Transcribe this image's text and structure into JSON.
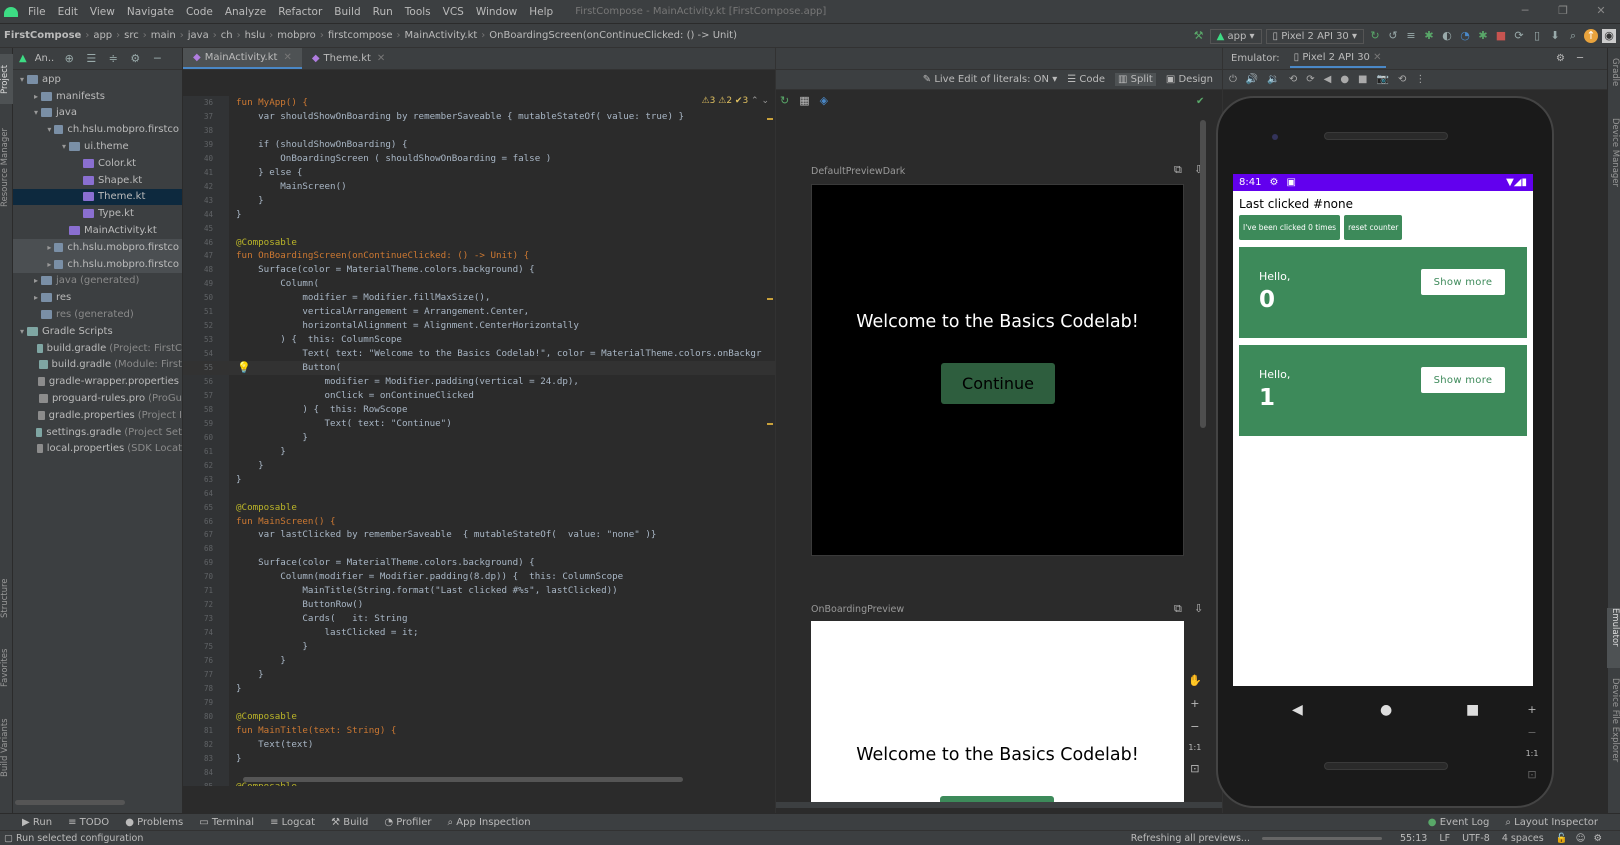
{
  "menu": {
    "items": [
      "File",
      "Edit",
      "View",
      "Navigate",
      "Code",
      "Analyze",
      "Refactor",
      "Build",
      "Run",
      "Tools",
      "VCS",
      "Window",
      "Help"
    ],
    "window_title": "FirstCompose - MainActivity.kt [FirstCompose.app]"
  },
  "nav": {
    "crumbs": [
      "FirstCompose",
      "app",
      "src",
      "main",
      "java",
      "ch",
      "hslu",
      "mobpro",
      "firstcompose",
      "MainActivity.kt",
      "OnBoardingScreen(onContinueClicked: () -> Unit)"
    ],
    "run_config": "app",
    "device": "Pixel 2 API 30"
  },
  "project": {
    "header": "An..",
    "tree": [
      {
        "label": "app",
        "extra": "",
        "depth": 0,
        "arrow": "▾",
        "icon": "folder",
        "cls": ""
      },
      {
        "label": "manifests",
        "extra": "",
        "depth": 1,
        "arrow": "▸",
        "icon": "folder",
        "cls": ""
      },
      {
        "label": "java",
        "extra": "",
        "depth": 1,
        "arrow": "▾",
        "icon": "folder",
        "cls": ""
      },
      {
        "label": "ch.hslu.mobpro.firstco",
        "extra": "",
        "depth": 2,
        "arrow": "▾",
        "icon": "pkg",
        "cls": ""
      },
      {
        "label": "ui.theme",
        "extra": "",
        "depth": 3,
        "arrow": "▾",
        "icon": "pkg",
        "cls": ""
      },
      {
        "label": "Color.kt",
        "extra": "",
        "depth": 4,
        "arrow": "",
        "icon": "kt",
        "cls": ""
      },
      {
        "label": "Shape.kt",
        "extra": "",
        "depth": 4,
        "arrow": "",
        "icon": "kt",
        "cls": ""
      },
      {
        "label": "Theme.kt",
        "extra": "",
        "depth": 4,
        "arrow": "",
        "icon": "kt",
        "cls": "sel"
      },
      {
        "label": "Type.kt",
        "extra": "",
        "depth": 4,
        "arrow": "",
        "icon": "kt",
        "cls": ""
      },
      {
        "label": "MainActivity.kt",
        "extra": "",
        "depth": 3,
        "arrow": "",
        "icon": "kt",
        "cls": ""
      },
      {
        "label": "ch.hslu.mobpro.firstco",
        "extra": "",
        "depth": 2,
        "arrow": "▸",
        "icon": "pkg",
        "cls": "sel2"
      },
      {
        "label": "ch.hslu.mobpro.firstco",
        "extra": "",
        "depth": 2,
        "arrow": "▸",
        "icon": "pkg",
        "cls": "sel2"
      },
      {
        "label": "java",
        "extra": "(generated)",
        "depth": 1,
        "arrow": "▸",
        "icon": "folder",
        "cls": ""
      },
      {
        "label": "res",
        "extra": "",
        "depth": 1,
        "arrow": "▸",
        "icon": "folder",
        "cls": ""
      },
      {
        "label": "res",
        "extra": "(generated)",
        "depth": 1,
        "arrow": "",
        "icon": "folder",
        "cls": ""
      },
      {
        "label": "Gradle Scripts",
        "extra": "",
        "depth": 0,
        "arrow": "▾",
        "icon": "gradle",
        "cls": ""
      },
      {
        "label": "build.gradle",
        "extra": "(Project: FirstC",
        "depth": 1,
        "arrow": "",
        "icon": "gradle",
        "cls": ""
      },
      {
        "label": "build.gradle",
        "extra": "(Module: First",
        "depth": 1,
        "arrow": "",
        "icon": "gradle",
        "cls": ""
      },
      {
        "label": "gradle-wrapper.properties",
        "extra": "",
        "depth": 1,
        "arrow": "",
        "icon": "file",
        "cls": ""
      },
      {
        "label": "proguard-rules.pro",
        "extra": "(ProGu",
        "depth": 1,
        "arrow": "",
        "icon": "file",
        "cls": ""
      },
      {
        "label": "gradle.properties",
        "extra": "(Project I",
        "depth": 1,
        "arrow": "",
        "icon": "file",
        "cls": ""
      },
      {
        "label": "settings.gradle",
        "extra": "(Project Set",
        "depth": 1,
        "arrow": "",
        "icon": "gradle",
        "cls": ""
      },
      {
        "label": "local.properties",
        "extra": "(SDK Locat",
        "depth": 1,
        "arrow": "",
        "icon": "file",
        "cls": ""
      }
    ]
  },
  "editor": {
    "tabs": [
      "MainActivity.kt",
      "Theme.kt"
    ],
    "warnings": "⚠3 ⚠2 ✔3",
    "lines": [
      {
        "n": "36",
        "t": "fun MyApp() {"
      },
      {
        "n": "37",
        "t": "    var shouldShowOnBoarding by rememberSaveable { mutableStateOf( value: true) }"
      },
      {
        "n": "38",
        "t": ""
      },
      {
        "n": "39",
        "t": "    if (shouldShowOnBoarding) {"
      },
      {
        "n": "40",
        "t": "        OnBoardingScreen ( shouldShowOnBoarding = false )"
      },
      {
        "n": "41",
        "t": "    } else {"
      },
      {
        "n": "42",
        "t": "        MainScreen()"
      },
      {
        "n": "43",
        "t": "    }"
      },
      {
        "n": "44",
        "t": "}"
      },
      {
        "n": "45",
        "t": ""
      },
      {
        "n": "46",
        "t": "@Composable"
      },
      {
        "n": "47",
        "t": "fun OnBoardingScreen(onContinueClicked: () -> Unit) {"
      },
      {
        "n": "48",
        "t": "    Surface(color = MaterialTheme.colors.background) {"
      },
      {
        "n": "49",
        "t": "        Column("
      },
      {
        "n": "50",
        "t": "            modifier = Modifier.fillMaxSize(),"
      },
      {
        "n": "51",
        "t": "            verticalArrangement = Arrangement.Center,"
      },
      {
        "n": "52",
        "t": "            horizontalAlignment = Alignment.CenterHorizontally"
      },
      {
        "n": "53",
        "t": "        ) {  this: ColumnScope"
      },
      {
        "n": "54",
        "t": "            Text( text: \"Welcome to the Basics Codelab!\", color = MaterialTheme.colors.onBackgr"
      },
      {
        "n": "55",
        "t": "            Button("
      },
      {
        "n": "56",
        "t": "                modifier = Modifier.padding(vertical = 24.dp),"
      },
      {
        "n": "57",
        "t": "                onClick = onContinueClicked"
      },
      {
        "n": "58",
        "t": "            ) {  this: RowScope"
      },
      {
        "n": "59",
        "t": "                Text( text: \"Continue\")"
      },
      {
        "n": "60",
        "t": "            }"
      },
      {
        "n": "61",
        "t": "        }"
      },
      {
        "n": "62",
        "t": "    }"
      },
      {
        "n": "63",
        "t": "}"
      },
      {
        "n": "64",
        "t": ""
      },
      {
        "n": "65",
        "t": "@Composable"
      },
      {
        "n": "66",
        "t": "fun MainScreen() {"
      },
      {
        "n": "67",
        "t": "    var lastClicked by rememberSaveable  { mutableStateOf(  value: \"none\" )}"
      },
      {
        "n": "68",
        "t": ""
      },
      {
        "n": "69",
        "t": "    Surface(color = MaterialTheme.colors.background) {"
      },
      {
        "n": "70",
        "t": "        Column(modifier = Modifier.padding(8.dp)) {  this: ColumnScope"
      },
      {
        "n": "71",
        "t": "            MainTitle(String.format(\"Last clicked #%s\", lastClicked))"
      },
      {
        "n": "72",
        "t": "            ButtonRow()"
      },
      {
        "n": "73",
        "t": "            Cards(   it: String"
      },
      {
        "n": "74",
        "t": "                lastClicked = it;"
      },
      {
        "n": "75",
        "t": "            }"
      },
      {
        "n": "76",
        "t": "        }"
      },
      {
        "n": "77",
        "t": "    }"
      },
      {
        "n": "78",
        "t": "}"
      },
      {
        "n": "79",
        "t": ""
      },
      {
        "n": "80",
        "t": "@Composable"
      },
      {
        "n": "81",
        "t": "fun MainTitle(text: String) {"
      },
      {
        "n": "82",
        "t": "    Text(text)"
      },
      {
        "n": "83",
        "t": "}"
      },
      {
        "n": "84",
        "t": ""
      },
      {
        "n": "85",
        "t": "@Composable"
      }
    ]
  },
  "preview": {
    "toolbar": {
      "live_edit": "Live Edit of literals: ON",
      "code": "Code",
      "split": "Split",
      "design": "Design"
    },
    "panels": [
      {
        "name": "DefaultPreviewDark",
        "welcome": "Welcome to the Basics Codelab!",
        "button": "Continue"
      },
      {
        "name": "OnBoardingPreview",
        "welcome": "Welcome to the Basics Codelab!"
      }
    ],
    "zoom": "1:1"
  },
  "emulator": {
    "label": "Emulator:",
    "tab": "Pixel 2 API 30",
    "time": "8:41",
    "last_clicked": "Last clicked #none",
    "btn_clicked": "I've been clicked 0 times",
    "btn_reset": "reset counter",
    "cards": [
      {
        "hello": "Hello,",
        "num": "0",
        "btn": "Show more"
      },
      {
        "hello": "Hello,",
        "num": "1",
        "btn": "Show more"
      }
    ],
    "zoom": "1:1"
  },
  "bottom": {
    "tabs": [
      "Run",
      "TODO",
      "Problems",
      "Terminal",
      "Logcat",
      "Build",
      "Profiler",
      "App Inspection"
    ],
    "right": [
      "Event Log",
      "Layout Inspector"
    ]
  },
  "status": {
    "left": "Run selected configuration",
    "refresh": "Refreshing all previews...",
    "pos": "55:13",
    "lf": "LF",
    "enc": "UTF-8",
    "indent": "4 spaces"
  },
  "colors": {
    "purple": "#6200ee",
    "green": "#3d8a5a",
    "darkgreen": "#2e5e3e"
  },
  "left_tools": [
    "Project",
    "Resource Manager",
    "Structure",
    "Favorites",
    "Build Variants"
  ],
  "right_tools": [
    "Gradle",
    "Device Manager",
    "Emulator",
    "Device File Explorer"
  ]
}
